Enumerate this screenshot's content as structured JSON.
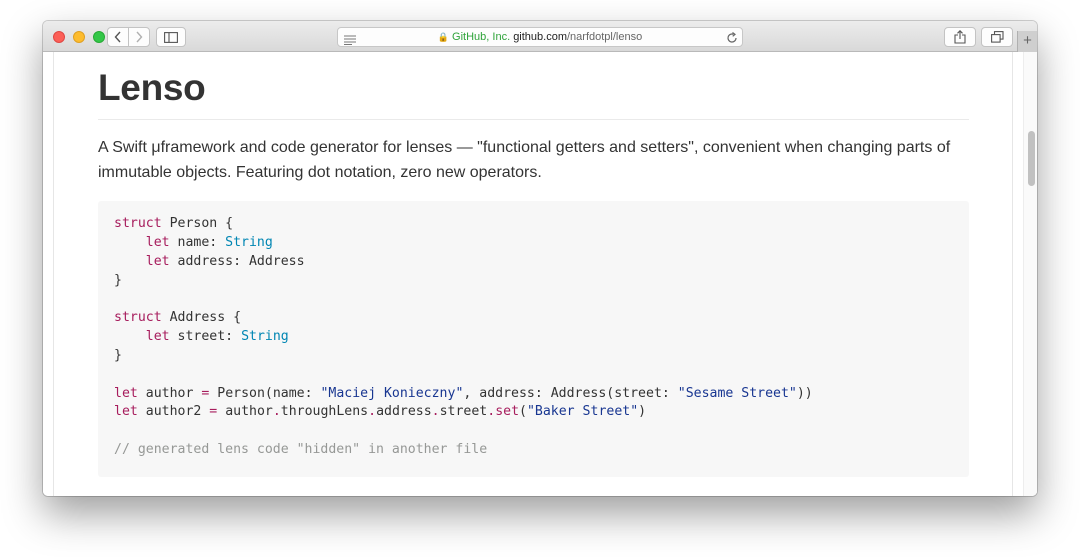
{
  "browser": {
    "org": "GitHub, Inc.",
    "host": "github.com",
    "path": "/narfdotpl/lenso",
    "new_tab": "+",
    "icons": [
      "lock-icon",
      "back-icon",
      "forward-icon",
      "sidebar-icon",
      "reader-icon",
      "reload-icon",
      "share-icon",
      "tabs-icon"
    ]
  },
  "readme": {
    "title": "Lenso",
    "description": "A Swift μframework and code generator for lenses — \"functional getters and setters\", convenient when changing parts of immutable objects. Featuring dot notation, zero new operators."
  },
  "code": {
    "language": "swift",
    "lines": [
      [
        {
          "t": "struct",
          "c": "kw"
        },
        {
          "t": " Person {"
        }
      ],
      [
        {
          "t": "    "
        },
        {
          "t": "let",
          "c": "kw"
        },
        {
          "t": " name: "
        },
        {
          "t": "String",
          "c": "ty"
        }
      ],
      [
        {
          "t": "    "
        },
        {
          "t": "let",
          "c": "kw"
        },
        {
          "t": " address: Address"
        }
      ],
      [
        {
          "t": "}"
        }
      ],
      [],
      [
        {
          "t": "struct",
          "c": "kw"
        },
        {
          "t": " Address {"
        }
      ],
      [
        {
          "t": "    "
        },
        {
          "t": "let",
          "c": "kw"
        },
        {
          "t": " street: "
        },
        {
          "t": "String",
          "c": "ty"
        }
      ],
      [
        {
          "t": "}"
        }
      ],
      [],
      [
        {
          "t": "let",
          "c": "kw"
        },
        {
          "t": " author "
        },
        {
          "t": "=",
          "c": "kw"
        },
        {
          "t": " Person(name: "
        },
        {
          "t": "\"Maciej Konieczny\"",
          "c": "st"
        },
        {
          "t": ", address: Address(street: "
        },
        {
          "t": "\"Sesame Street\"",
          "c": "st"
        },
        {
          "t": "))"
        }
      ],
      [
        {
          "t": "let",
          "c": "kw"
        },
        {
          "t": " author2 "
        },
        {
          "t": "=",
          "c": "kw"
        },
        {
          "t": " author"
        },
        {
          "t": ".",
          "c": "kw"
        },
        {
          "t": "throughLens"
        },
        {
          "t": ".",
          "c": "kw"
        },
        {
          "t": "address"
        },
        {
          "t": ".",
          "c": "kw"
        },
        {
          "t": "street"
        },
        {
          "t": ".",
          "c": "kw"
        },
        {
          "t": "set",
          "c": "kw"
        },
        {
          "t": "("
        },
        {
          "t": "\"Baker Street\"",
          "c": "st"
        },
        {
          "t": ")"
        }
      ],
      [],
      [
        {
          "t": "// generated lens code \"hidden\" in another file",
          "c": "cm"
        }
      ]
    ]
  },
  "colors": {
    "keyword": "#a71d5d",
    "type": "#0086b3",
    "string": "#183691",
    "comment": "#969896",
    "secure": "#2fa33a"
  }
}
